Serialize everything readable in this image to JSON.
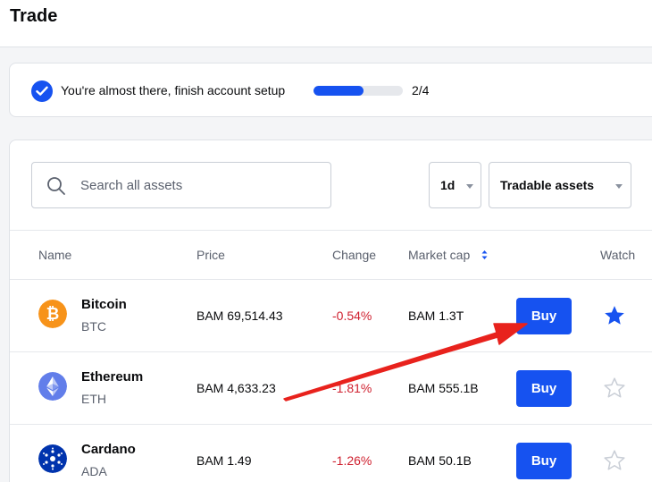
{
  "page": {
    "title": "Trade"
  },
  "setup": {
    "message": "You're almost there, finish account setup",
    "progress_fraction": 0.56,
    "progress_label": "2/4"
  },
  "search": {
    "placeholder": "Search all assets"
  },
  "filters": {
    "period": "1d",
    "asset_filter": "Tradable assets"
  },
  "table": {
    "headers": {
      "name": "Name",
      "price": "Price",
      "change": "Change",
      "market_cap": "Market cap",
      "watch": "Watch"
    },
    "rows": [
      {
        "name": "Bitcoin",
        "ticker": "BTC",
        "price": "BAM 69,514.43",
        "change": "-0.54%",
        "market_cap": "BAM 1.3T",
        "buy_label": "Buy",
        "watched": true
      },
      {
        "name": "Ethereum",
        "ticker": "ETH",
        "price": "BAM 4,633.23",
        "change": "-1.81%",
        "market_cap": "BAM 555.1B",
        "buy_label": "Buy",
        "watched": false
      },
      {
        "name": "Cardano",
        "ticker": "ADA",
        "price": "BAM 1.49",
        "change": "-1.26%",
        "market_cap": "BAM 50.1B",
        "buy_label": "Buy",
        "watched": false
      }
    ]
  },
  "colors": {
    "brand_blue": "#1652f0",
    "negative_red": "#cf202f",
    "bitcoin_orange": "#f7931a",
    "ethereum_purple": "#627eea",
    "cardano_navy": "#0033ad",
    "annotation_arrow": "#e8221d"
  },
  "icons": {
    "bitcoin": "bitcoin-icon",
    "ethereum": "ethereum-icon",
    "cardano": "cardano-icon",
    "watch_filled": "star-filled-icon",
    "watch_empty": "star-outline-icon"
  }
}
